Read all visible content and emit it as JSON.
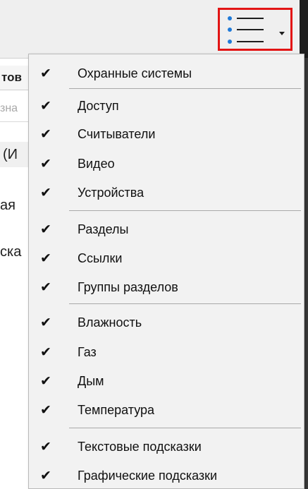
{
  "background": {
    "header_fragment": "тов",
    "filter_fragment": "зна",
    "group_fragment": "(И",
    "row_fragments": [
      "ая",
      "ска"
    ]
  },
  "toolbar": {
    "list_button_icon": "bulleted-list-icon",
    "highlight_color": "#e21414",
    "accent_color": "#1f7ad8"
  },
  "menu": {
    "check_glyph": "✔",
    "items": [
      {
        "label": "Охранные системы",
        "checked": true
      },
      {
        "label": "Доступ",
        "checked": true
      },
      {
        "label": "Считыватели",
        "checked": true
      },
      {
        "label": "Видео",
        "checked": true
      },
      {
        "label": "Устройства",
        "checked": true
      },
      {
        "label": "Разделы",
        "checked": true
      },
      {
        "label": "Ссылки",
        "checked": true
      },
      {
        "label": "Группы разделов",
        "checked": true
      },
      {
        "label": "Влажность",
        "checked": true
      },
      {
        "label": "Газ",
        "checked": true
      },
      {
        "label": "Дым",
        "checked": true
      },
      {
        "label": "Температура",
        "checked": true
      },
      {
        "label": "Текстовые подсказки",
        "checked": true
      },
      {
        "label": "Графические подсказки",
        "checked": true
      }
    ]
  }
}
